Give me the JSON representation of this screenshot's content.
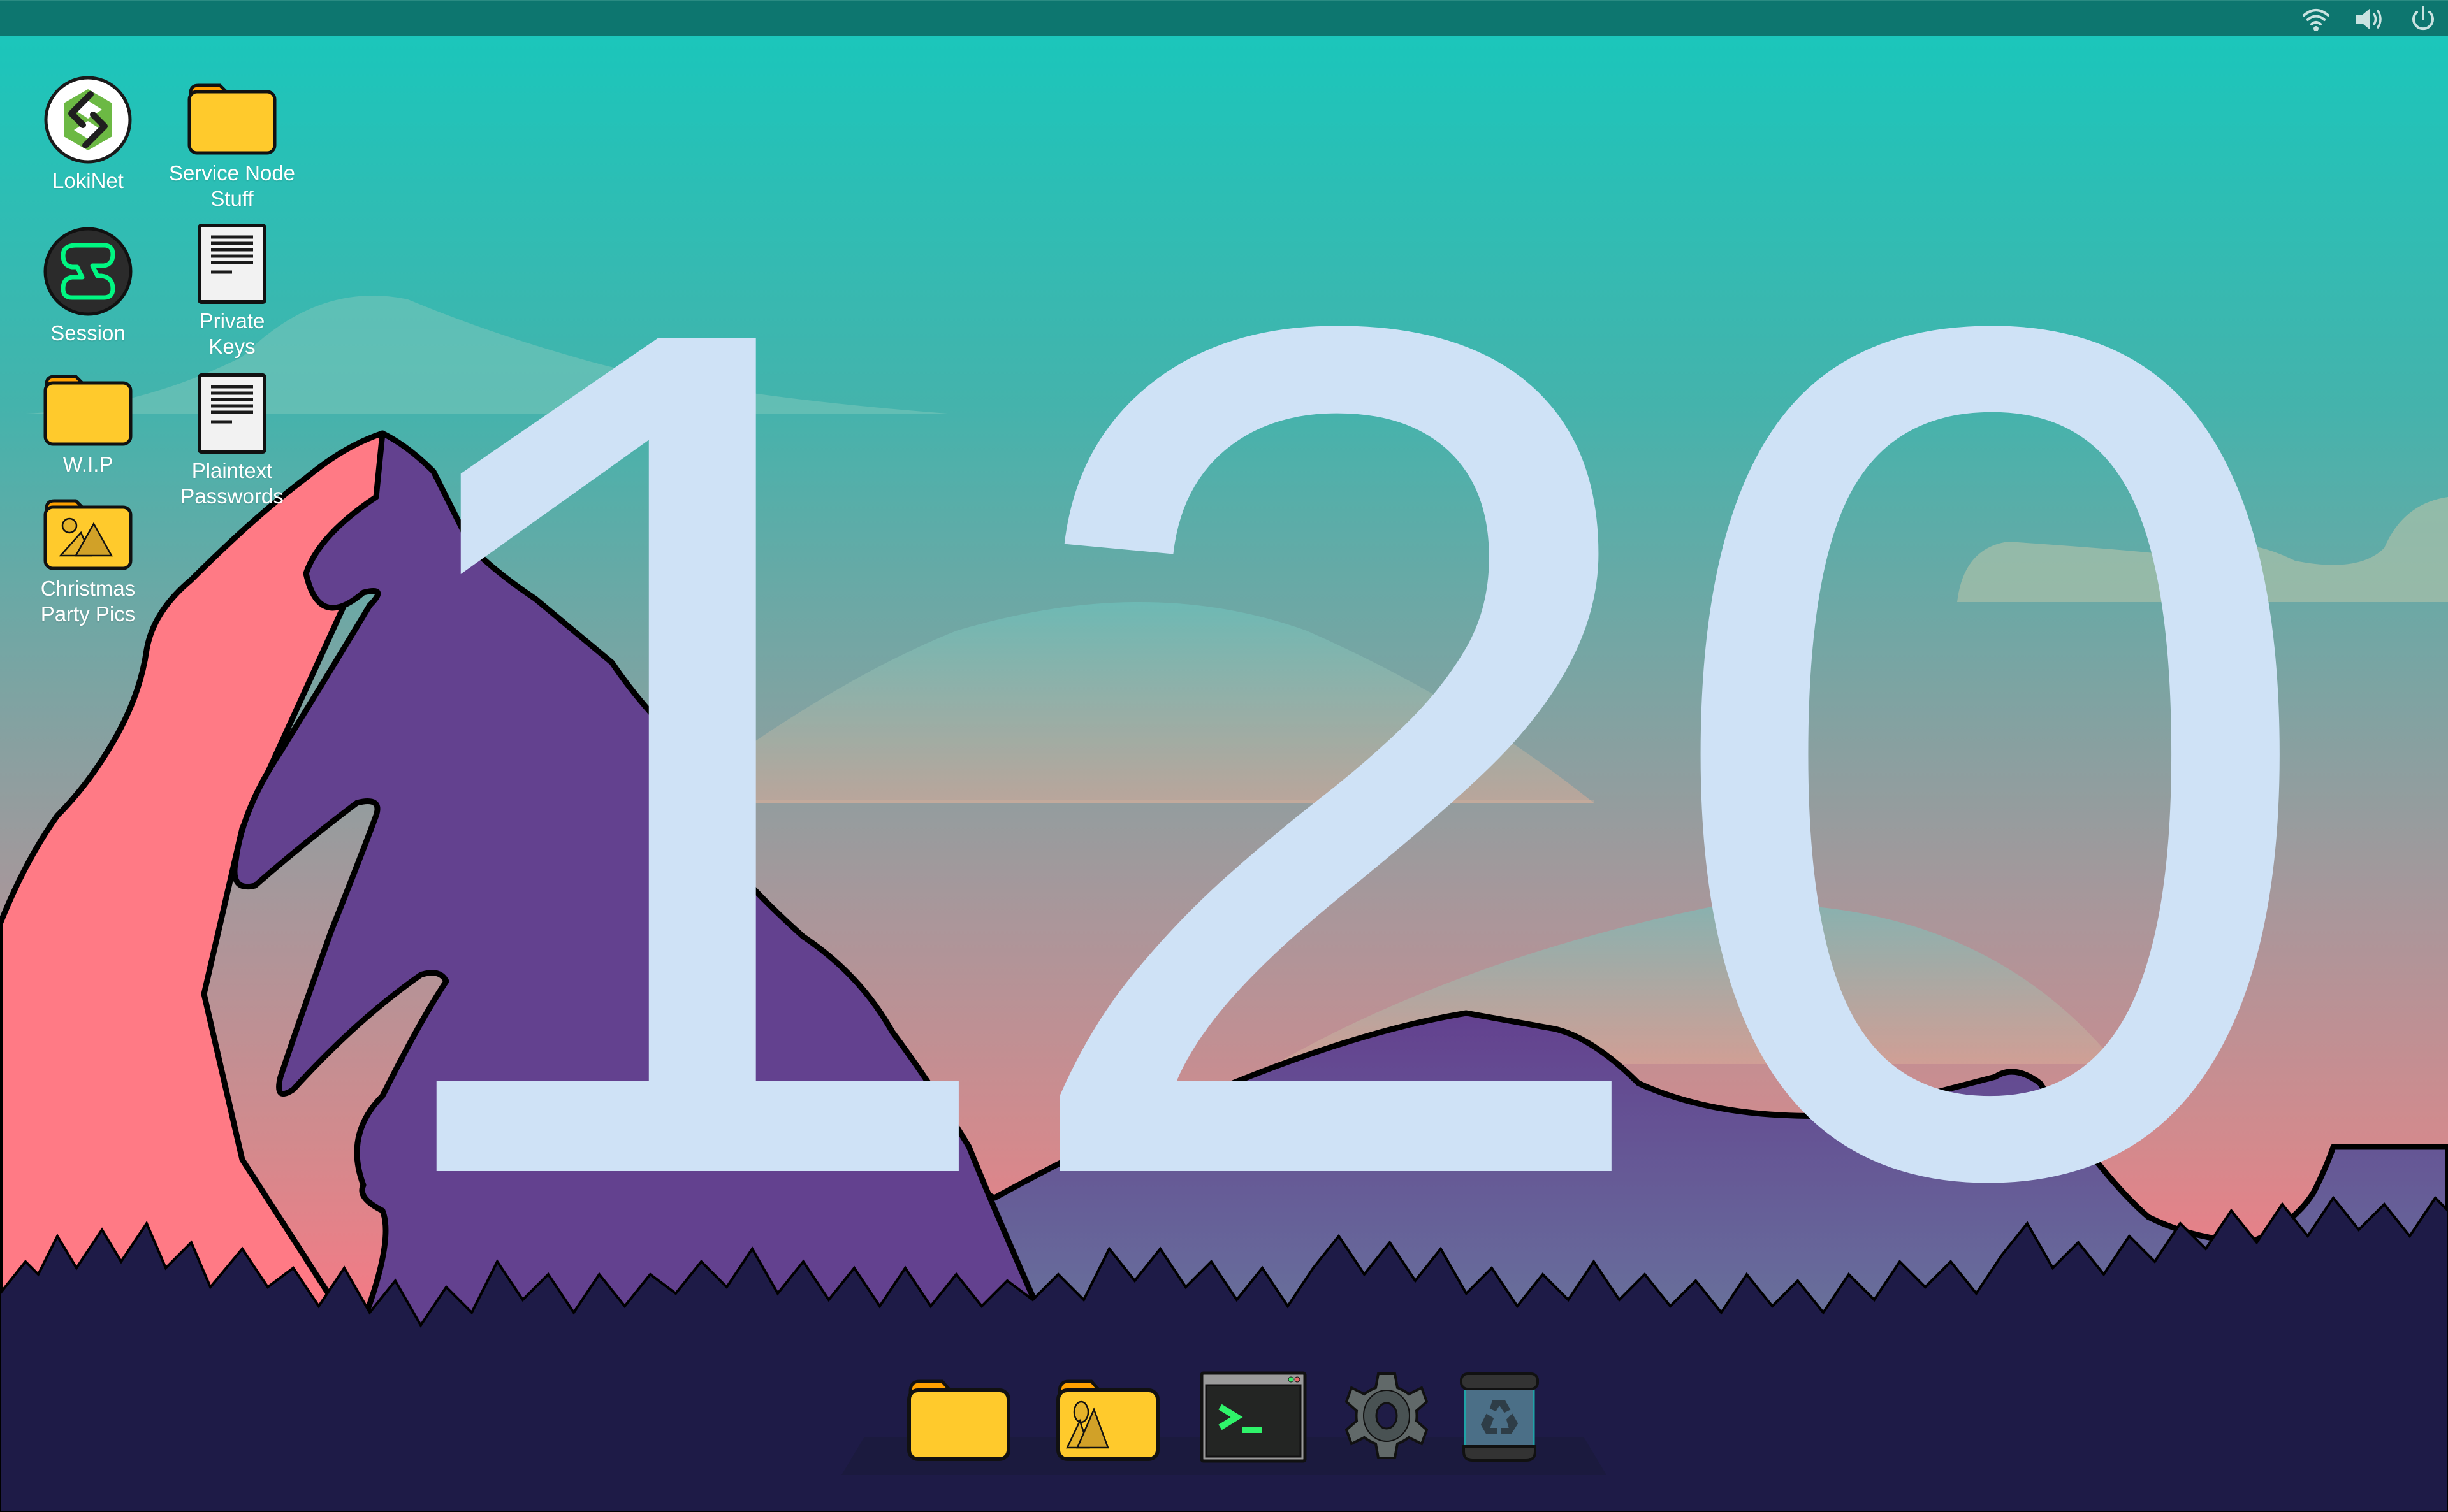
{
  "screen": {
    "wallpaper": "mountains-sunset",
    "overlay_number": "120",
    "colors": {
      "topbar": "#0d766f",
      "overlay_number": "#cfe2f6",
      "mountain_purple": "#634190",
      "mountain_pink": "#ff7a85",
      "forest": "#1e1b47",
      "folder_yellow": "#ffca2c",
      "folder_tab": "#ffa000"
    }
  },
  "topbar": {
    "tray": [
      {
        "name": "wifi",
        "icon": "wifi-icon"
      },
      {
        "name": "volume",
        "icon": "volume-icon"
      },
      {
        "name": "power",
        "icon": "power-icon"
      }
    ]
  },
  "desktop": {
    "icons": [
      {
        "id": "lokinet",
        "label": "LokiNet",
        "type": "app",
        "icon": "lokinet-icon"
      },
      {
        "id": "service-node-stuff",
        "label": "Service Node Stuff",
        "label_lines": [
          "Service Node",
          "Stuff"
        ],
        "type": "folder",
        "icon": "folder-icon"
      },
      {
        "id": "session",
        "label": "Session",
        "type": "app",
        "icon": "session-icon"
      },
      {
        "id": "private-keys",
        "label": "Private Keys",
        "label_lines": [
          "Private",
          "Keys"
        ],
        "type": "document",
        "icon": "document-icon"
      },
      {
        "id": "wip",
        "label": "W.I.P",
        "type": "folder",
        "icon": "folder-icon"
      },
      {
        "id": "plaintext-passwords",
        "label": "Plaintext Passwords",
        "label_lines": [
          "Plaintext",
          "Passwords"
        ],
        "type": "document",
        "icon": "document-icon"
      },
      {
        "id": "christmas-party-pics",
        "label": "Christmas Party Pics",
        "label_lines": [
          "Christmas",
          "Party Pics"
        ],
        "type": "pictures-folder",
        "icon": "pictures-folder-icon"
      }
    ]
  },
  "dock": {
    "items": [
      {
        "id": "files",
        "icon": "folder-icon"
      },
      {
        "id": "pictures",
        "icon": "pictures-folder-icon"
      },
      {
        "id": "terminal",
        "icon": "terminal-icon",
        "prompt": ">_"
      },
      {
        "id": "settings",
        "icon": "gear-icon"
      },
      {
        "id": "trash",
        "icon": "recycle-bin-icon"
      }
    ]
  }
}
